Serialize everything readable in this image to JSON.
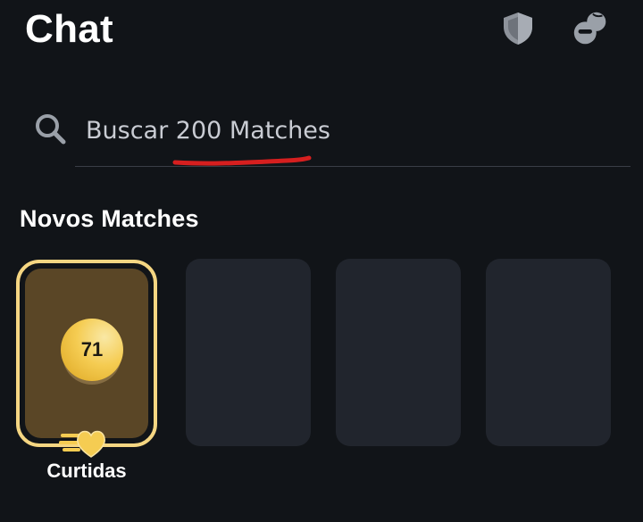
{
  "header": {
    "title": "Chat",
    "icons": [
      "shield-icon",
      "match-pair-icon"
    ]
  },
  "search": {
    "placeholder": "Buscar 200 Matches",
    "value": ""
  },
  "new_matches": {
    "title": "Novos Matches",
    "likes_card": {
      "count": "71",
      "label": "Curtidas"
    },
    "placeholder_cards": 3
  },
  "colors": {
    "background": "#111418",
    "card": "#21252d",
    "likes_border": "#f5d682",
    "likes_fill": "#5a4626",
    "gold": "#f5cc52",
    "annotation_red": "#d61f1f"
  }
}
